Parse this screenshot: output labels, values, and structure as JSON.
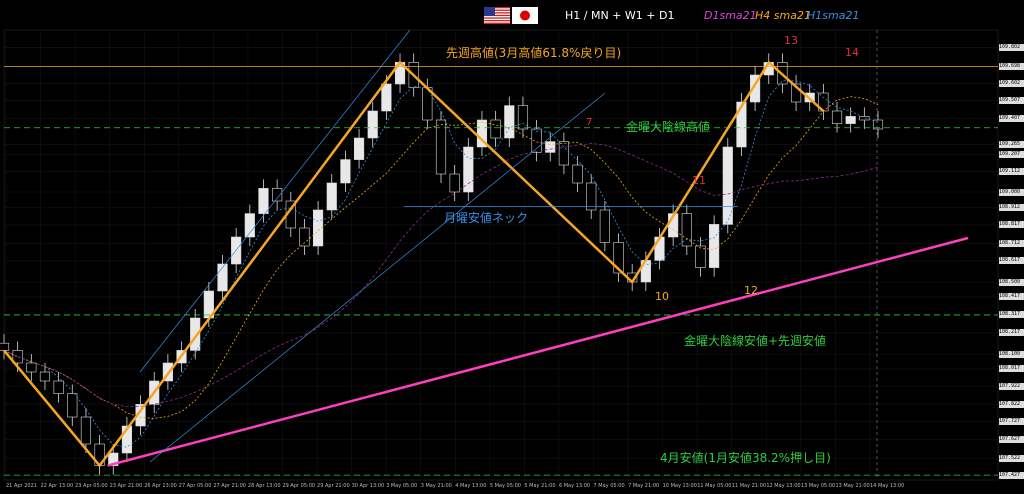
{
  "header": {
    "timeframes": "H1 / MN + W1 + D1",
    "d1_label": "D1sma21",
    "h4_label": "H4 sma21",
    "h1_label": "H1sma21",
    "d1_color": "#e040e0",
    "h4_color": "#f5a623",
    "h1_color": "#3a8ee6"
  },
  "flags": [
    "us-flag-icon",
    "japan-flag-icon"
  ],
  "annotations": {
    "prev_week_high": "先週高値(3月高値61.8%戻り目)",
    "friday_bear_high": "金曜大陰線高値",
    "monday_low_neck": "月曜安値ネック",
    "friday_bear_low": "金曜大陰線安値+先週安値",
    "april_low": "4月安値(1月安値38.2%押し目)"
  },
  "wave_labels": [
    "7",
    "10",
    "11",
    "12",
    "13",
    "14"
  ],
  "chart_data": {
    "type": "line",
    "series": [
      {
        "values": [
          108.12,
          108.05,
          108.0,
          107.95,
          107.88,
          107.75,
          107.6,
          107.48,
          107.55,
          107.7,
          107.82,
          107.95,
          108.05,
          108.12,
          108.3,
          108.45,
          108.6,
          108.75,
          108.88,
          109.02,
          108.95,
          108.8,
          108.7,
          108.9,
          109.05,
          109.18,
          109.3,
          109.45,
          109.6,
          109.72,
          109.58,
          109.4,
          109.1,
          109.0,
          109.25,
          109.4,
          109.3,
          109.48,
          109.35,
          109.22,
          109.28,
          109.15,
          109.05,
          108.9,
          108.72,
          108.55,
          108.5,
          108.62,
          108.75,
          108.88,
          108.7,
          108.58,
          108.82,
          109.25,
          109.5,
          109.65,
          109.72,
          109.6,
          109.5,
          109.55,
          109.45,
          109.38,
          109.42,
          109.4,
          109.35
        ]
      }
    ],
    "price_ticks": [
      "109.802",
      "109.698",
      "109.602",
      "109.507",
      "109.407",
      "109.265",
      "109.207",
      "109.112",
      "109.000",
      "108.912",
      "108.817",
      "108.712",
      "108.617",
      "108.500",
      "108.417",
      "108.317",
      "108.217",
      "108.100",
      "108.017",
      "107.922",
      "107.822",
      "107.727",
      "107.627",
      "107.522",
      "107.427"
    ],
    "x_ticks": [
      "21 Apr 2021",
      "22 Apr 13:00",
      "23 Apr 05:00",
      "23 Apr 21:00",
      "26 Apr 13:00",
      "27 Apr 05:00",
      "27 Apr 21:00",
      "28 Apr 13:00",
      "29 Apr 05:00",
      "29 Apr 21:00",
      "30 Apr 13:00",
      "3 May 05:00",
      "3 May 21:00",
      "4 May 13:00",
      "5 May 05:00",
      "5 May 21:00",
      "6 May 13:00",
      "7 May 05:00",
      "7 May 21:00",
      "10 May 13:00",
      "11 May 05:00",
      "11 May 21:00",
      "12 May 13:00",
      "13 May 05:00",
      "13 May 21:00",
      "14 May 13:00"
    ],
    "levels": {
      "prev_week_high": 109.698,
      "friday_bear_high": 109.357,
      "friday_bear_low": 108.317,
      "april_low": 107.427
    },
    "ylim": [
      107.4,
      109.9
    ],
    "grid": true
  }
}
